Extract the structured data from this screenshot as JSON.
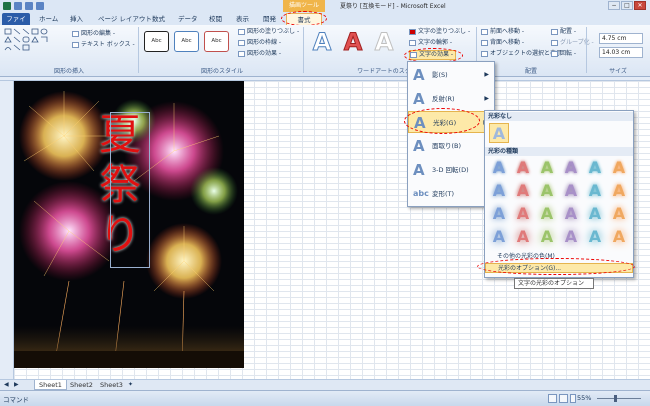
{
  "window": {
    "title": "夏祭り [互換モード] - Microsoft Excel",
    "context_tool": "描画ツール",
    "min": "−",
    "max": "□",
    "close": "✕"
  },
  "tabs": [
    "ファイル",
    "ホーム",
    "挿入",
    "ページ レイアウト",
    "数式",
    "データ",
    "校閲",
    "表示",
    "開発",
    "書式"
  ],
  "ribbon": {
    "insert_shapes": {
      "edit_shape": "図形の編集 -",
      "text_box": "テキスト ボックス -",
      "label": "図形の挿入"
    },
    "shape_styles": {
      "presets": [
        "Abc",
        "Abc",
        "Abc"
      ],
      "fill": "図形の塗りつぶし -",
      "outline": "図形の枠線 -",
      "effects": "図形の効果 -",
      "label": "図形のスタイル"
    },
    "wordart_styles": {
      "fill": "文字の塗りつぶし -",
      "outline": "文字の輪郭 -",
      "effects": "文字の効果 -",
      "label": "ワードアートのスタイル"
    },
    "arrange": {
      "bring_forward": "前面へ移動 -",
      "send_backward": "背面へ移動 -",
      "selection_pane": "オブジェクトの選択と表示",
      "align": "配置 -",
      "group": "グループ化 -",
      "rotate": "回転 -",
      "label": "配置"
    },
    "size": {
      "height": "4.75 cm",
      "width": "14.03 cm",
      "label": "サイズ"
    }
  },
  "picture": {
    "text": "夏祭り"
  },
  "effects_menu": [
    {
      "label": "影(S)",
      "glyph": "A"
    },
    {
      "label": "反射(R)",
      "glyph": "A"
    },
    {
      "label": "光彩(G)",
      "glyph": "A"
    },
    {
      "label": "面取り(B)",
      "glyph": "A"
    },
    {
      "label": "3-D 回転(D)",
      "glyph": "A"
    },
    {
      "label": "変形(T)",
      "glyph": "abc"
    }
  ],
  "glow_panel": {
    "no_glow_header": "光彩なし",
    "variations_header": "光彩の種類",
    "more_colors": "その他の光彩の色(M)",
    "options": "光彩のオプション(G)..."
  },
  "tooltip": "文字の光彩のオプション",
  "sheets": [
    "Sheet1",
    "Sheet2",
    "Sheet3"
  ],
  "status": {
    "mode": "コマンド",
    "zoom": "55%"
  },
  "colors": {
    "accent": "#2b5ca8",
    "highlight": "#fde9a8",
    "annotation": "#ee0000",
    "wordart_red": "#e01010"
  }
}
